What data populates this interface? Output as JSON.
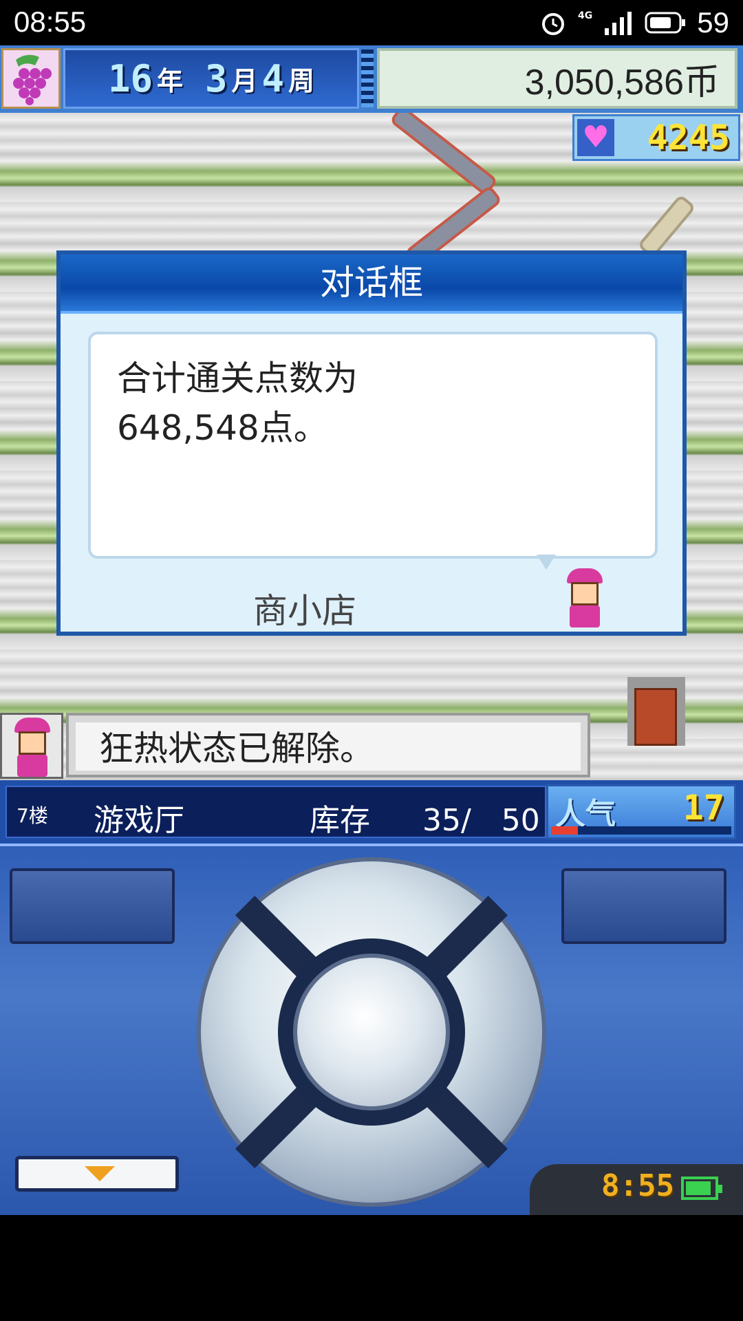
{
  "status_bar": {
    "time": "08:55",
    "network": "4G",
    "battery": "59"
  },
  "hud": {
    "year_num": "16",
    "year_label": "年",
    "month_num": "3",
    "month_label": "月",
    "week_num": "4",
    "week_label": "周",
    "money": "3,050,586币",
    "hearts": "4245"
  },
  "dialog": {
    "title": "对话框",
    "message": "合计通关点数为\n648,548点。",
    "speaker": "商小店"
  },
  "notification": {
    "text": "狂热状态已解除。"
  },
  "info_bar": {
    "floor": "7楼",
    "facility": "游戏厅",
    "stock_label": "库存",
    "stock_value": "35/　50",
    "popularity_label": "人气",
    "popularity_value": "17",
    "popularity_fraction": 0.15
  },
  "controller": {
    "clock": "8:55"
  },
  "colors": {
    "dialog_title_blue": "#0a48a8",
    "money_bg": "#dfeee0",
    "hearts_yellow": "#ffe437",
    "popularity_red": "#e84030",
    "battery_green": "#3ad050"
  }
}
